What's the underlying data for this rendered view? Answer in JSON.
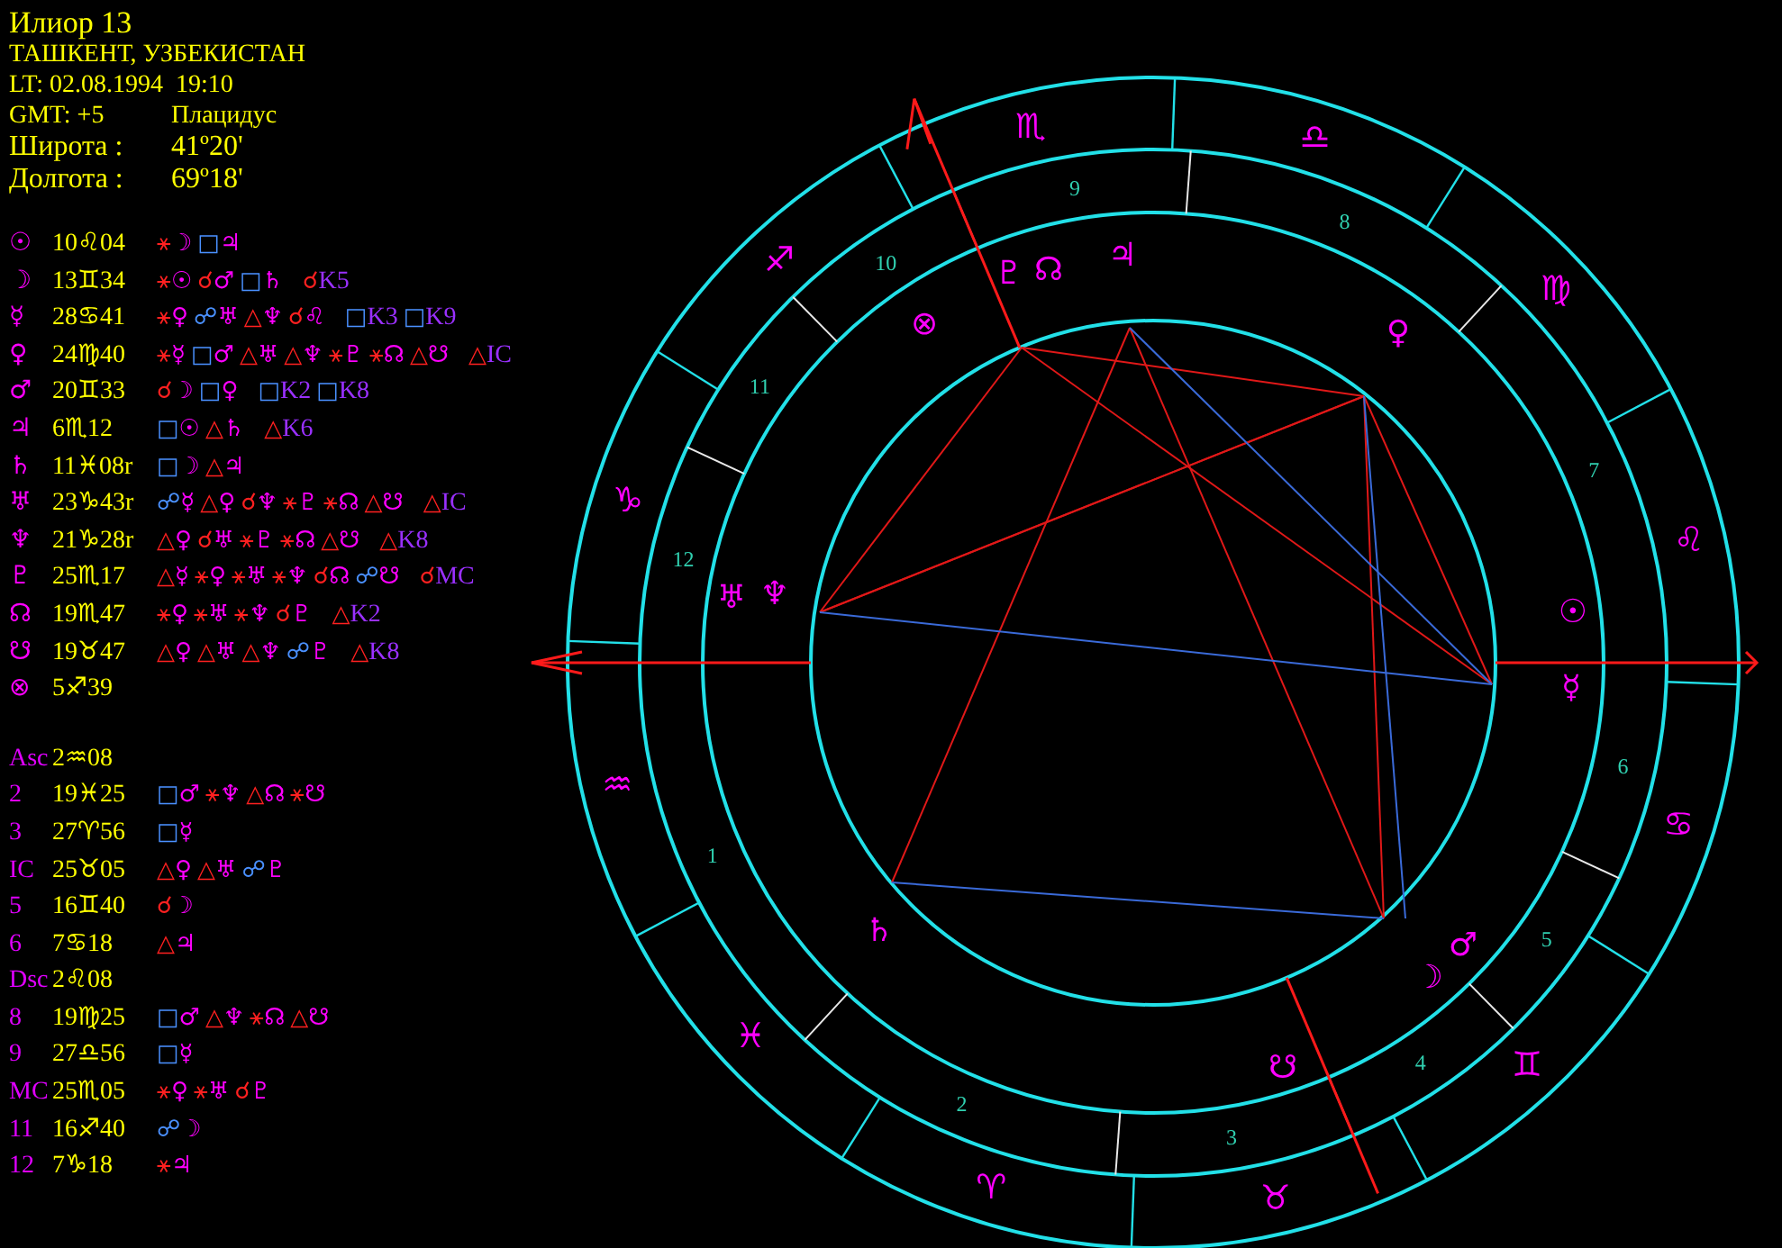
{
  "header": {
    "title": "Илиор 13",
    "place": "ТАШКЕНТ, УЗБЕКИСТАН",
    "local_time": "LT: 02.08.1994  19:10",
    "gmt": "GMT: +5",
    "house_system": "Плацидус",
    "latitude_label": "Широта :",
    "latitude": "41º20'",
    "longitude_label": "Долгота :",
    "longitude": "69º18'"
  },
  "planets": [
    {
      "glyph": "☉",
      "position": "10♌04",
      "aspects": [
        {
          "kind": "sextile",
          "symbol": "⚹",
          "target": "☽"
        },
        {
          "kind": "square",
          "symbol": "□",
          "target": "♃"
        }
      ]
    },
    {
      "glyph": "☽",
      "position": "13♊34",
      "aspects": [
        {
          "kind": "sextile",
          "symbol": "⚹",
          "target": "☉"
        },
        {
          "kind": "conjunction",
          "symbol": "☌",
          "target": "♂"
        },
        {
          "kind": "square",
          "symbol": "□",
          "target": "♄"
        }
      ],
      "cusps": [
        {
          "kind": "conjunction",
          "symbol": "☌",
          "target": "K5"
        }
      ]
    },
    {
      "glyph": "☿",
      "position": "28♋41",
      "aspects": [
        {
          "kind": "sextile",
          "symbol": "⚹",
          "target": "♀"
        },
        {
          "kind": "opposition",
          "symbol": "☍",
          "target": "♅"
        },
        {
          "kind": "trine",
          "symbol": "△",
          "target": "♆"
        },
        {
          "kind": "conjunction",
          "symbol": "☌",
          "target": "♌"
        }
      ],
      "cusps": [
        {
          "kind": "square",
          "symbol": "□",
          "target": "K3"
        },
        {
          "kind": "square",
          "symbol": "□",
          "target": "K9"
        }
      ]
    },
    {
      "glyph": "♀",
      "position": "24♍40",
      "aspects": [
        {
          "kind": "sextile",
          "symbol": "⚹",
          "target": "☿"
        },
        {
          "kind": "square",
          "symbol": "□",
          "target": "♂"
        },
        {
          "kind": "trine",
          "symbol": "△",
          "target": "♅"
        },
        {
          "kind": "trine",
          "symbol": "△",
          "target": "♆"
        },
        {
          "kind": "sextile",
          "symbol": "⚹",
          "target": "♇"
        },
        {
          "kind": "sextile",
          "symbol": "⚹",
          "target": "☊"
        },
        {
          "kind": "trine",
          "symbol": "△",
          "target": "☋"
        }
      ],
      "cusps": [
        {
          "kind": "trine",
          "symbol": "△",
          "target": "IC"
        }
      ]
    },
    {
      "glyph": "♂",
      "position": "20♊33",
      "aspects": [
        {
          "kind": "conjunction",
          "symbol": "☌",
          "target": "☽"
        },
        {
          "kind": "square",
          "symbol": "□",
          "target": "♀"
        }
      ],
      "cusps": [
        {
          "kind": "square",
          "symbol": "□",
          "target": "K2"
        },
        {
          "kind": "square",
          "symbol": "□",
          "target": "K8"
        }
      ]
    },
    {
      "glyph": "♃",
      "position": "6♏12",
      "aspects": [
        {
          "kind": "square",
          "symbol": "□",
          "target": "☉"
        },
        {
          "kind": "trine",
          "symbol": "△",
          "target": "♄"
        }
      ],
      "cusps": [
        {
          "kind": "trine",
          "symbol": "△",
          "target": "K6"
        }
      ]
    },
    {
      "glyph": "♄",
      "position": "11♓08r",
      "aspects": [
        {
          "kind": "square",
          "symbol": "□",
          "target": "☽"
        },
        {
          "kind": "trine",
          "symbol": "△",
          "target": "♃"
        }
      ]
    },
    {
      "glyph": "♅",
      "position": "23♑43r",
      "aspects": [
        {
          "kind": "opposition",
          "symbol": "☍",
          "target": "☿"
        },
        {
          "kind": "trine",
          "symbol": "△",
          "target": "♀"
        },
        {
          "kind": "conjunction",
          "symbol": "☌",
          "target": "♆"
        },
        {
          "kind": "sextile",
          "symbol": "⚹",
          "target": "♇"
        },
        {
          "kind": "sextile",
          "symbol": "⚹",
          "target": "☊"
        },
        {
          "kind": "trine",
          "symbol": "△",
          "target": "☋"
        }
      ],
      "cusps": [
        {
          "kind": "trine",
          "symbol": "△",
          "target": "IC"
        }
      ]
    },
    {
      "glyph": "♆",
      "position": "21♑28r",
      "aspects": [
        {
          "kind": "trine",
          "symbol": "△",
          "target": "♀"
        },
        {
          "kind": "conjunction",
          "symbol": "☌",
          "target": "♅"
        },
        {
          "kind": "sextile",
          "symbol": "⚹",
          "target": "♇"
        },
        {
          "kind": "sextile",
          "symbol": "⚹",
          "target": "☊"
        },
        {
          "kind": "trine",
          "symbol": "△",
          "target": "☋"
        }
      ],
      "cusps": [
        {
          "kind": "trine",
          "symbol": "△",
          "target": "K8"
        }
      ]
    },
    {
      "glyph": "♇",
      "position": "25♏17",
      "aspects": [
        {
          "kind": "trine",
          "symbol": "△",
          "target": "☿"
        },
        {
          "kind": "sextile",
          "symbol": "⚹",
          "target": "♀"
        },
        {
          "kind": "sextile",
          "symbol": "⚹",
          "target": "♅"
        },
        {
          "kind": "sextile",
          "symbol": "⚹",
          "target": "♆"
        },
        {
          "kind": "conjunction",
          "symbol": "☌",
          "target": "☊"
        },
        {
          "kind": "opposition",
          "symbol": "☍",
          "target": "☋"
        }
      ],
      "cusps": [
        {
          "kind": "conjunction",
          "symbol": "☌",
          "target": "MC"
        }
      ]
    },
    {
      "glyph": "☊",
      "position": "19♏47",
      "aspects": [
        {
          "kind": "sextile",
          "symbol": "⚹",
          "target": "♀"
        },
        {
          "kind": "sextile",
          "symbol": "⚹",
          "target": "♅"
        },
        {
          "kind": "sextile",
          "symbol": "⚹",
          "target": "♆"
        },
        {
          "kind": "conjunction",
          "symbol": "☌",
          "target": "♇"
        }
      ],
      "cusps": [
        {
          "kind": "trine",
          "symbol": "△",
          "target": "K2"
        }
      ]
    },
    {
      "glyph": "☋",
      "position": "19♉47",
      "aspects": [
        {
          "kind": "trine",
          "symbol": "△",
          "target": "♀"
        },
        {
          "kind": "trine",
          "symbol": "△",
          "target": "♅"
        },
        {
          "kind": "trine",
          "symbol": "△",
          "target": "♆"
        },
        {
          "kind": "opposition",
          "symbol": "☍",
          "target": "♇"
        }
      ],
      "cusps": [
        {
          "kind": "trine",
          "symbol": "△",
          "target": "K8"
        }
      ]
    },
    {
      "glyph": "⊗",
      "position": "5♐39"
    }
  ],
  "houses": [
    {
      "label": "Asc",
      "position": "2♒08"
    },
    {
      "label": "2",
      "position": "19♓25",
      "aspects": [
        {
          "kind": "square",
          "symbol": "□",
          "target": "♂"
        },
        {
          "kind": "sextile",
          "symbol": "⚹",
          "target": "♆"
        },
        {
          "kind": "trine",
          "symbol": "△",
          "target": "☊"
        },
        {
          "kind": "sextile",
          "symbol": "⚹",
          "target": "☋"
        }
      ]
    },
    {
      "label": "3",
      "position": "27♈56",
      "aspects": [
        {
          "kind": "square",
          "symbol": "□",
          "target": "☿"
        }
      ]
    },
    {
      "label": "IC",
      "position": "25♉05",
      "aspects": [
        {
          "kind": "trine",
          "symbol": "△",
          "target": "♀"
        },
        {
          "kind": "trine",
          "symbol": "△",
          "target": "♅"
        },
        {
          "kind": "opposition",
          "symbol": "☍",
          "target": "♇"
        }
      ]
    },
    {
      "label": "5",
      "position": "16♊40",
      "aspects": [
        {
          "kind": "conjunction",
          "symbol": "☌",
          "target": "☽"
        }
      ]
    },
    {
      "label": "6",
      "position": "7♋18",
      "aspects": [
        {
          "kind": "trine",
          "symbol": "△",
          "target": "♃"
        }
      ]
    },
    {
      "label": "Dsc",
      "position": "2♌08"
    },
    {
      "label": "8",
      "position": "19♍25",
      "aspects": [
        {
          "kind": "square",
          "symbol": "□",
          "target": "♂"
        },
        {
          "kind": "trine",
          "symbol": "△",
          "target": "♆"
        },
        {
          "kind": "sextile",
          "symbol": "⚹",
          "target": "☊"
        },
        {
          "kind": "trine",
          "symbol": "△",
          "target": "☋"
        }
      ]
    },
    {
      "label": "9",
      "position": "27♎56",
      "aspects": [
        {
          "kind": "square",
          "symbol": "□",
          "target": "☿"
        }
      ]
    },
    {
      "label": "MC",
      "position": "25♏05",
      "aspects": [
        {
          "kind": "sextile",
          "symbol": "⚹",
          "target": "♀"
        },
        {
          "kind": "sextile",
          "symbol": "⚹",
          "target": "♅"
        },
        {
          "kind": "conjunction",
          "symbol": "☌",
          "target": "♇"
        }
      ]
    },
    {
      "label": "11",
      "position": "16♐40",
      "aspects": [
        {
          "kind": "opposition",
          "symbol": "☍",
          "target": "☽"
        }
      ]
    },
    {
      "label": "12",
      "position": "7♑18",
      "aspects": [
        {
          "kind": "sextile",
          "symbol": "⚹",
          "target": "♃"
        }
      ]
    }
  ],
  "wheel": {
    "signs": [
      "♈",
      "♉",
      "♊",
      "♋",
      "♌",
      "♍",
      "♎",
      "♏",
      "♐",
      "♑",
      "♒",
      "♓"
    ],
    "houses": [
      "1",
      "2",
      "3",
      "4",
      "5",
      "6",
      "7",
      "8",
      "9",
      "10",
      "11",
      "12"
    ],
    "planets": [
      "☉",
      "☿",
      "♀",
      "♃",
      "♇",
      "☊",
      "⊗",
      "♅",
      "♆",
      "♄",
      "♂",
      "☽",
      "☋"
    ]
  }
}
